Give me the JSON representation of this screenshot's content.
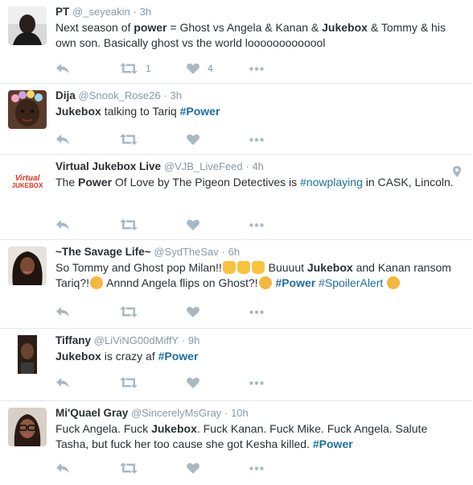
{
  "tweets": [
    {
      "name": "PT",
      "handle": "@_seyeakin",
      "separator": "·",
      "time": "3h",
      "segments": [
        {
          "t": "Next season of "
        },
        {
          "t": "power",
          "b": true
        },
        {
          "t": " = Ghost vs Angela & Kanan & "
        },
        {
          "t": "Jukebox",
          "b": true
        },
        {
          "t": " & Tommy & his own son. Basically ghost vs the world looooooooooool"
        }
      ],
      "retweets": "1",
      "likes": "4",
      "avatar_icon": "avatar-photo-icon"
    },
    {
      "name": "Dija",
      "handle": "@Snook_Rose26",
      "separator": "·",
      "time": "3h",
      "segments": [
        {
          "t": "Jukebox",
          "b": true
        },
        {
          "t": " talking to Tariq "
        },
        {
          "t": "#Power",
          "tag": true,
          "b": true
        }
      ],
      "retweets": "",
      "likes": "",
      "avatar_icon": "avatar-photo-icon"
    },
    {
      "name": "Virtual Jukebox Live",
      "handle": "@VJB_LiveFeed",
      "separator": "·",
      "time": "4h",
      "segments": [
        {
          "t": "The "
        },
        {
          "t": "Power",
          "b": true
        },
        {
          "t": " Of Love by The Pigeon Detectives is "
        },
        {
          "t": "#nowplaying",
          "tag": true
        },
        {
          "t": " in CASK, Lincoln."
        }
      ],
      "retweets": "",
      "likes": "",
      "avatar_icon": "virtual-jukebox-logo",
      "logo_text_line1": "Virtual",
      "logo_text_line2": "JUKEBOX",
      "has_location": true
    },
    {
      "name": "~The Savage Life~",
      "handle": "@SydTheSav",
      "separator": "·",
      "time": "6h",
      "segments": [
        {
          "t": "So Tommy and Ghost pop Milan!!"
        },
        {
          "e": "clapping-hands-emoji"
        },
        {
          "e": "clapping-hands-emoji"
        },
        {
          "e": "raised-hands-emoji"
        },
        {
          "t": " Buuuut "
        },
        {
          "t": "Jukebox",
          "b": true
        },
        {
          "t": " and Kanan ransom Tariq?!"
        },
        {
          "e": "astonished-face-emoji"
        },
        {
          "t": " Annnd Angela flips on Ghost?!"
        },
        {
          "e": "astonished-face-emoji"
        },
        {
          "t": " "
        },
        {
          "t": "#Power",
          "tag": true,
          "b": true
        },
        {
          "t": " "
        },
        {
          "t": "#SpoilerAlert",
          "tag": true
        },
        {
          "t": " "
        },
        {
          "e": "tongue-wink-face-emoji"
        }
      ],
      "retweets": "",
      "likes": "",
      "avatar_icon": "avatar-photo-icon"
    },
    {
      "name": "Tiffany",
      "handle": "@LiViNG00dMiffY",
      "separator": "·",
      "time": "9h",
      "segments": [
        {
          "t": "Jukebox",
          "b": true
        },
        {
          "t": " is crazy af "
        },
        {
          "t": "#Power",
          "tag": true,
          "b": true
        }
      ],
      "retweets": "",
      "likes": "",
      "avatar_icon": "avatar-photo-icon"
    },
    {
      "name": "Mi'Quael Gray",
      "handle": "@SincerelyMsGray",
      "separator": "·",
      "time": "10h",
      "segments": [
        {
          "t": "Fuck Angela. Fuck "
        },
        {
          "t": "Jukebox",
          "b": true
        },
        {
          "t": ". Fuck Kanan. Fuck Mike. Fuck Angela. Salute Tasha, but fuck her too cause she got Kesha killed. "
        },
        {
          "t": "#Power",
          "tag": true,
          "b": true
        }
      ],
      "retweets": "",
      "likes": "",
      "avatar_icon": "avatar-photo-icon"
    }
  ],
  "colors": {
    "name": "#292f33",
    "meta": "#8899a6",
    "hashtag": "#1b6ea0",
    "icon": "#aab8c2",
    "divider": "#e1e8ed"
  }
}
